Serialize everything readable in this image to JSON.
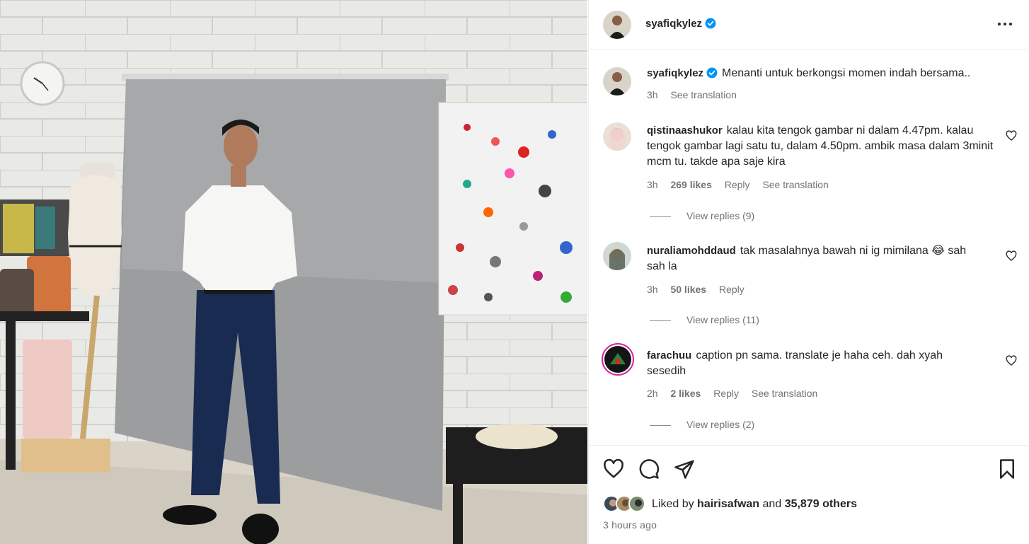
{
  "post": {
    "username": "syafiqkylez",
    "verified": true,
    "caption": "Menanti untuk berkongsi momen indah bersama..",
    "caption_time": "3h",
    "see_translation": "See translation"
  },
  "comments": [
    {
      "username": "qistinaashukor",
      "text": "kalau kita tengok gambar ni dalam 4.47pm. kalau tengok gambar lagi satu tu, dalam 4.50pm. ambik masa dalam 3minit mcm tu. takde apa saje kira",
      "time": "3h",
      "likes": "269 likes",
      "reply": "Reply",
      "see_translation": "See translation",
      "view_replies": "View replies (9)"
    },
    {
      "username": "nuraliamohddaud",
      "text": "tak masalahnya bawah ni ig mimilana 😂 sah sah la",
      "time": "3h",
      "likes": "50 likes",
      "reply": "Reply",
      "view_replies": "View replies (11)"
    },
    {
      "username": "farachuu",
      "text": "caption pn sama. translate je haha ceh. dah xyah sesedih",
      "time": "2h",
      "likes": "2 likes",
      "reply": "Reply",
      "see_translation": "See translation",
      "view_replies": "View replies (2)"
    }
  ],
  "likes": {
    "prefix": "Liked by",
    "user": "hairisafwan",
    "and": "and",
    "others": "35,879 others"
  },
  "timestamp": "3 hours ago",
  "icons": [
    "more-options-icon",
    "verified-badge-icon",
    "heart-icon",
    "comment-icon",
    "share-icon",
    "bookmark-icon"
  ],
  "colors": {
    "verified": "#0095f6",
    "text": "#262626",
    "muted": "#737373"
  }
}
